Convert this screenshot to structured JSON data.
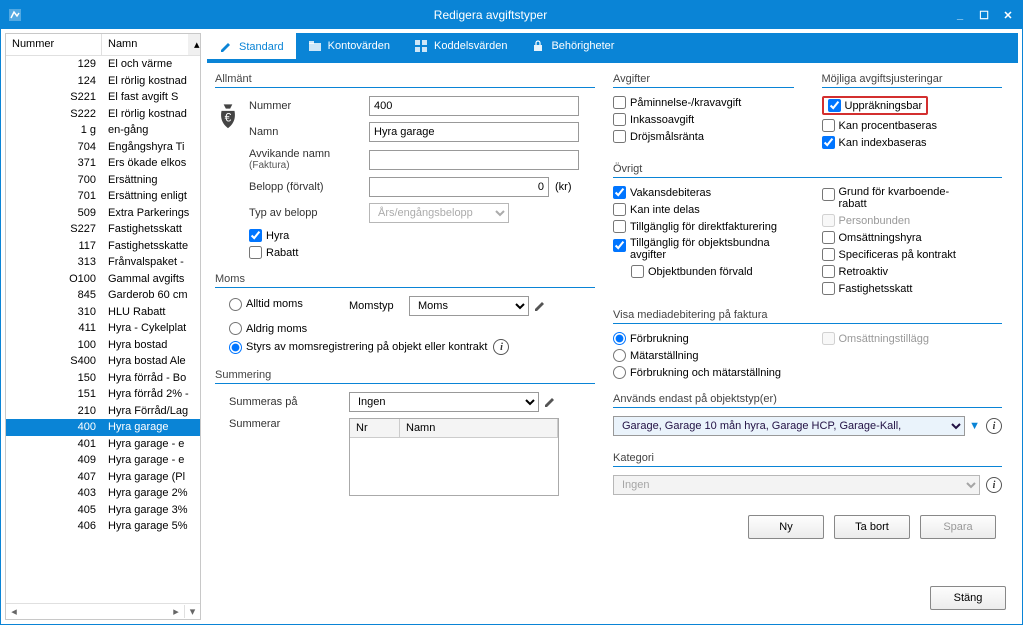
{
  "window": {
    "title": "Redigera avgiftstyper"
  },
  "list": {
    "header_num": "Nummer",
    "header_name": "Namn",
    "rows": [
      {
        "n": "129",
        "m": "El och värme"
      },
      {
        "n": "124",
        "m": "El rörlig kostnad"
      },
      {
        "n": "S221",
        "m": "El fast avgift S"
      },
      {
        "n": "S222",
        "m": "El rörlig kostnad"
      },
      {
        "n": "1 g",
        "m": "en-gång"
      },
      {
        "n": "704",
        "m": "Engångshyra Ti"
      },
      {
        "n": "371",
        "m": "Ers ökade elkos"
      },
      {
        "n": "700",
        "m": "Ersättning"
      },
      {
        "n": "701",
        "m": "Ersättning enligt"
      },
      {
        "n": "509",
        "m": "Extra Parkerings"
      },
      {
        "n": "S227",
        "m": "Fastighetsskatt"
      },
      {
        "n": "117",
        "m": "Fastighetsskatte"
      },
      {
        "n": "313",
        "m": "Frånvalspaket -"
      },
      {
        "n": "O100",
        "m": "Gammal avgifts"
      },
      {
        "n": "845",
        "m": "Garderob 60 cm"
      },
      {
        "n": "310",
        "m": "HLU Rabatt"
      },
      {
        "n": "411",
        "m": "Hyra - Cykelplat"
      },
      {
        "n": "100",
        "m": "Hyra bostad"
      },
      {
        "n": "S400",
        "m": "Hyra bostad Ale"
      },
      {
        "n": "150",
        "m": "Hyra förråd - Bo"
      },
      {
        "n": "151",
        "m": "Hyra förråd 2% -"
      },
      {
        "n": "210",
        "m": "Hyra Förråd/Lag"
      },
      {
        "n": "400",
        "m": "Hyra garage",
        "sel": true
      },
      {
        "n": "401",
        "m": "Hyra garage - e"
      },
      {
        "n": "409",
        "m": "Hyra garage - e"
      },
      {
        "n": "407",
        "m": "Hyra garage (Pl"
      },
      {
        "n": "403",
        "m": "Hyra garage 2%"
      },
      {
        "n": "405",
        "m": "Hyra garage 3%"
      },
      {
        "n": "406",
        "m": "Hyra garage 5%"
      }
    ]
  },
  "tabs": {
    "standard": "Standard",
    "konto": "Kontovärden",
    "koddel": "Koddelsvärden",
    "behor": "Behörigheter"
  },
  "allmant": {
    "legend": "Allmänt",
    "nummer_lbl": "Nummer",
    "nummer_val": "400",
    "namn_lbl": "Namn",
    "namn_val": "Hyra garage",
    "avvik_lbl1": "Avvikande namn",
    "avvik_lbl2": "(Faktura)",
    "avvik_val": "",
    "belopp_lbl": "Belopp (förvalt)",
    "belopp_val": "0",
    "belopp_unit": "(kr)",
    "typ_lbl": "Typ av belopp",
    "typ_val": "Års/engångsbelopp",
    "hyra_chk": "Hyra",
    "rabatt_chk": "Rabatt"
  },
  "avgifter": {
    "legend": "Avgifter",
    "paminnelse": "Påminnelse-/kravavgift",
    "inkasso": "Inkassoavgift",
    "drojsmal": "Dröjsmålsränta"
  },
  "justeringar": {
    "legend": "Möjliga avgiftsjusteringar",
    "uppr": "Uppräkningsbar",
    "procent": "Kan procentbaseras",
    "index": "Kan indexbaseras"
  },
  "ovrigt": {
    "legend": "Övrigt",
    "vakans": "Vakansdebiteras",
    "kaninte": "Kan inte delas",
    "direkt": "Tillgänglig för direktfakturering",
    "objbundna1": "Tillgänglig för objektsbundna",
    "objbundna2": "avgifter",
    "objforvald": "Objektbunden förvald",
    "grund1": "Grund för kvarboende-",
    "grund2": "rabatt",
    "personb": "Personbunden",
    "omshyra": "Omsättningshyra",
    "spec": "Specificeras på kontrakt",
    "retro": "Retroaktiv",
    "fskatt": "Fastighetsskatt"
  },
  "moms": {
    "legend": "Moms",
    "alltid": "Alltid moms",
    "aldrig": "Aldrig moms",
    "styrs": "Styrs av momsregistrering på objekt eller kontrakt",
    "typ_lbl": "Momstyp",
    "typ_val": "Moms"
  },
  "media": {
    "legend": "Visa mediadebitering på faktura",
    "forbr": "Förbrukning",
    "matar": "Mätarställning",
    "both": "Förbrukning och mätarställning",
    "omstill": "Omsättningstillägg"
  },
  "summering": {
    "legend": "Summering",
    "sumpa_lbl": "Summeras på",
    "sumpa_val": "Ingen",
    "sumr_lbl": "Summerar",
    "hdr_nr": "Nr",
    "hdr_namn": "Namn"
  },
  "anvands": {
    "legend": "Används endast på objektstyp(er)",
    "val": "Garage, Garage 10 mån hyra, Garage HCP, Garage-Kall,"
  },
  "kategori": {
    "legend": "Kategori",
    "val": "Ingen"
  },
  "buttons": {
    "ny": "Ny",
    "tabort": "Ta bort",
    "spara": "Spara",
    "stang": "Stäng"
  }
}
